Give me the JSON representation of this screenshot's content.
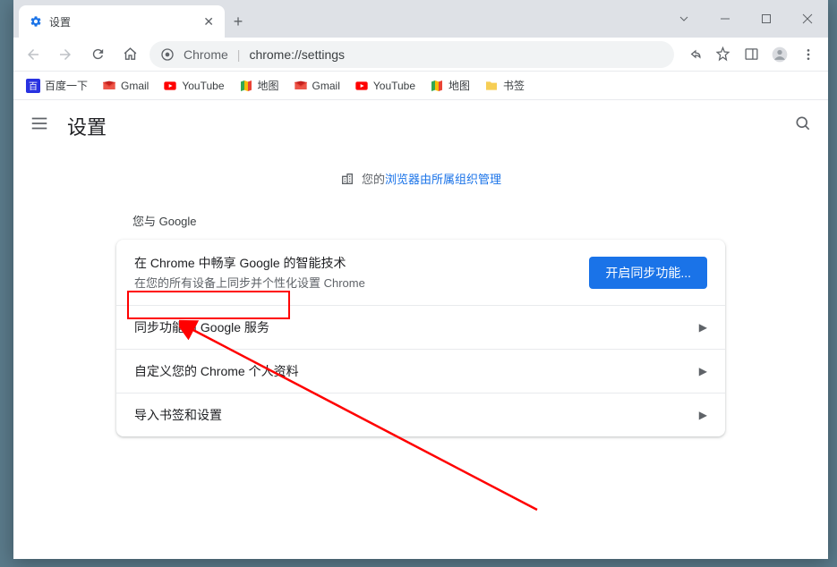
{
  "window": {
    "tab_title": "设置"
  },
  "address": {
    "prefix": "Chrome",
    "url": "chrome://settings"
  },
  "bookmarks": [
    {
      "label": "百度一下",
      "icon": "baidu"
    },
    {
      "label": "Gmail",
      "icon": "gmail"
    },
    {
      "label": "YouTube",
      "icon": "youtube"
    },
    {
      "label": "地图",
      "icon": "maps"
    },
    {
      "label": "Gmail",
      "icon": "gmail"
    },
    {
      "label": "YouTube",
      "icon": "youtube"
    },
    {
      "label": "地图",
      "icon": "maps"
    },
    {
      "label": "书签",
      "icon": "folder"
    }
  ],
  "settings": {
    "title": "设置",
    "managed_prefix": "您的",
    "managed_link": "浏览器由所属组织管理",
    "section_label": "您与 Google",
    "sync_title": "在 Chrome 中畅享 Google 的智能技术",
    "sync_subtitle": "在您的所有设备上同步并个性化设置 Chrome",
    "sync_button": "开启同步功能...",
    "rows": [
      {
        "label": "同步功能和 Google 服务"
      },
      {
        "label": "自定义您的 Chrome 个人资料"
      },
      {
        "label": "导入书签和设置"
      }
    ]
  }
}
